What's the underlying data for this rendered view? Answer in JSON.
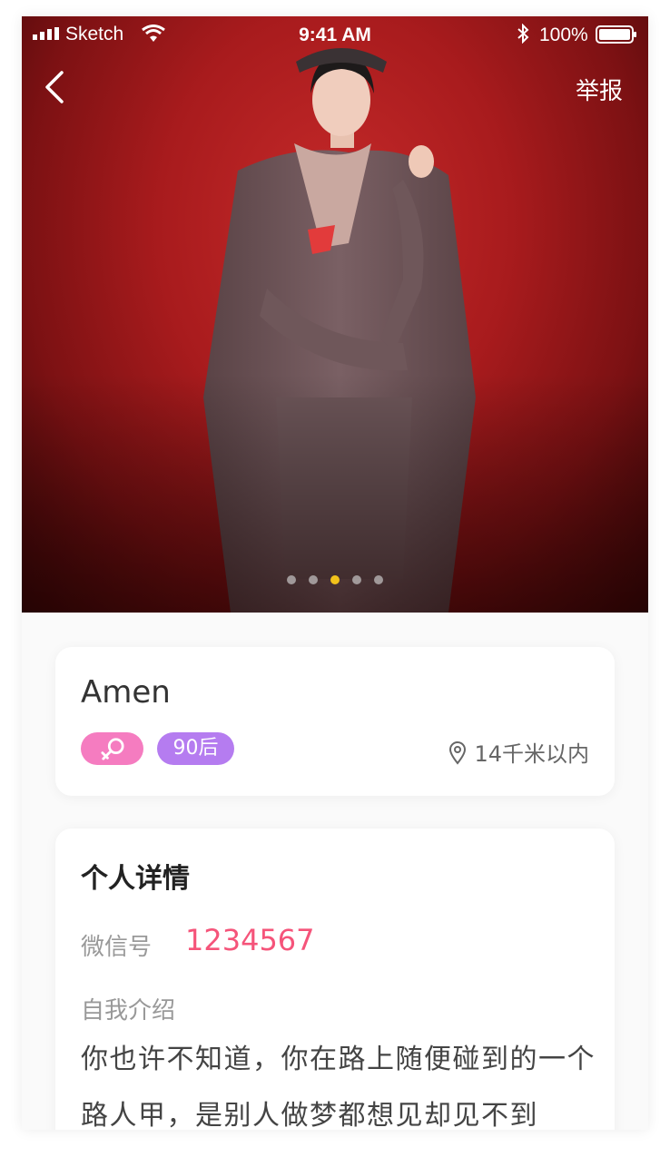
{
  "status_bar": {
    "carrier": "Sketch",
    "time": "9:41 AM",
    "battery": "100%"
  },
  "nav": {
    "back_icon": "chevron-left-icon",
    "report_label": "举报"
  },
  "carousel": {
    "count": 5,
    "active_index": 2,
    "active_color": "#f1c21b"
  },
  "profile": {
    "name": "Amen",
    "gender_icon": "female-icon",
    "gender_color": "#f57cc0",
    "age_tag": "90后",
    "age_color": "#b57cf0",
    "distance": "14千米以内"
  },
  "details": {
    "title": "个人详情",
    "wechat_label": "微信号",
    "wechat_value": "1234567",
    "wechat_color": "#f5547a",
    "intro_label": "自我介绍",
    "intro_text": "你也许不知道，你在路上随便碰到的一个路人甲，是别人做梦都想见却见不到"
  }
}
